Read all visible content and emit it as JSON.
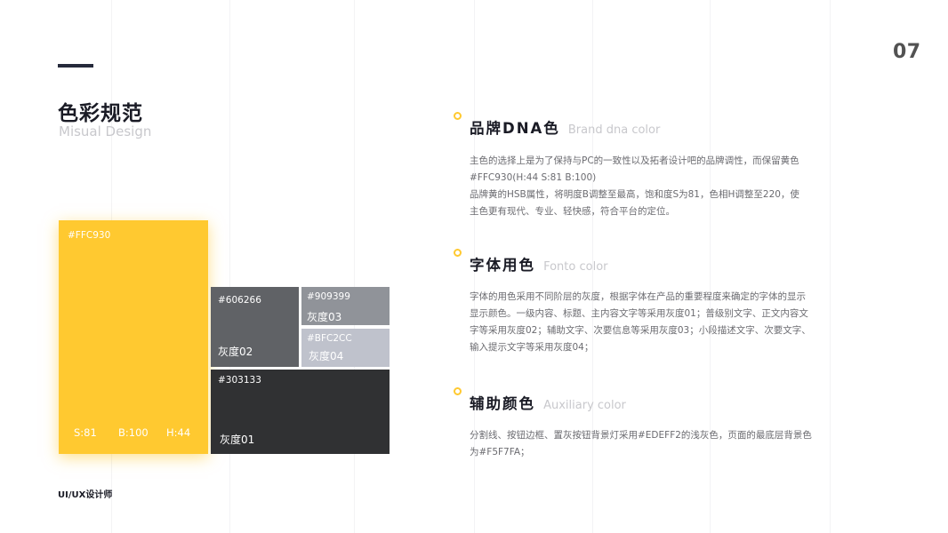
{
  "page": {
    "number": "07",
    "title_cn": "色彩规范",
    "title_en": "Misual Design",
    "footer": "UI/UX设计师"
  },
  "swatches": {
    "primary": {
      "code": "#FFC930",
      "s": "S:81",
      "b": "B:100",
      "h": "H:44",
      "color": "#FFC930"
    },
    "gray02": {
      "code": "#606266",
      "label": "灰度02",
      "color": "#606266"
    },
    "gray03": {
      "code": "#909399",
      "label": "灰度03",
      "color": "#909399"
    },
    "gray04": {
      "code": "#BFC2CC",
      "label": "灰度04",
      "color": "#BFC2CC"
    },
    "gray01": {
      "code": "#303133",
      "label": "灰度01",
      "color": "#303133"
    }
  },
  "sections": [
    {
      "title_cn": "品牌DNA色",
      "title_en": "Brand dna color",
      "lines": [
        "主色的选择上是为了保持与PC的一致性以及拓者设计吧的品牌调性，而保留黄色",
        "#FFC930(H:44  S:81  B:100)",
        "品牌黄的HSB属性，将明度B调整至最高，饱和度S为81，色相H调整至220，使",
        "主色更有现代、专业、轻快感，符合平台的定位。"
      ]
    },
    {
      "title_cn": "字体用色",
      "title_en": "Fonto color",
      "lines": [
        "字体的用色采用不同阶层的灰度，根据字体在产品的重要程度来确定的字体的显示",
        "显示颜色。一级内容、标题、主内容文字等采用灰度01；普级别文字、正文内容文",
        "字等采用灰度02；辅助文字、次要信息等采用灰度03；小段描述文字、次要文字、",
        "输入提示文字等采用灰度04；"
      ]
    },
    {
      "title_cn": "辅助颜色",
      "title_en": "Auxiliary color",
      "lines": [
        "分割线、按钮边框、置灰按钮背景灯采用#EDEFF2的浅灰色，页面的最底层背景色",
        "为#F5F7FA；"
      ]
    }
  ],
  "colors": {
    "accent": "#FFC930",
    "heading": "#1a1b25",
    "muted": "#c8c8cc",
    "body_text": "#6b6b70"
  }
}
